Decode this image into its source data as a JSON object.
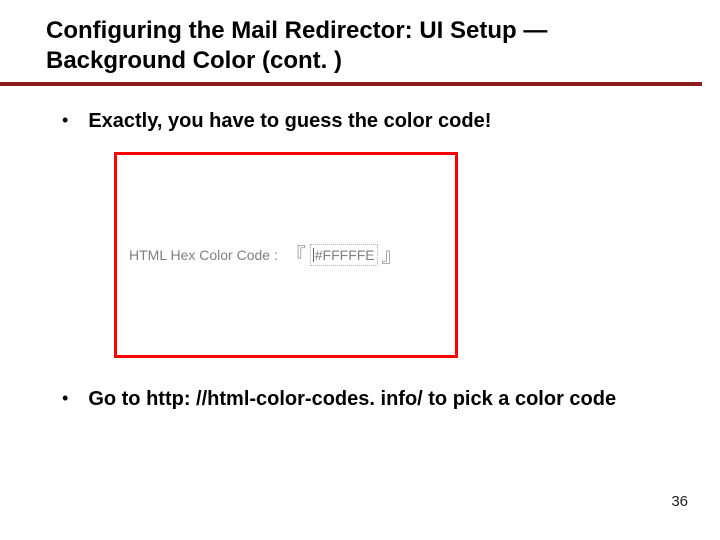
{
  "colors": {
    "rule": "#8a1e1e",
    "frame": "#ff0000"
  },
  "title": "Configuring the Mail Redirector: UI Setup — Background Color (cont. )",
  "bullets": {
    "first": "Exactly, you have to guess the color code!",
    "second": "Go to http: //html-color-codes. info/ to pick a color code"
  },
  "screenshot": {
    "label": "HTML Hex Color Code : ",
    "open_bracket": "『",
    "value": "#FFFFFE",
    "close_bracket": "』"
  },
  "page_number": "36"
}
